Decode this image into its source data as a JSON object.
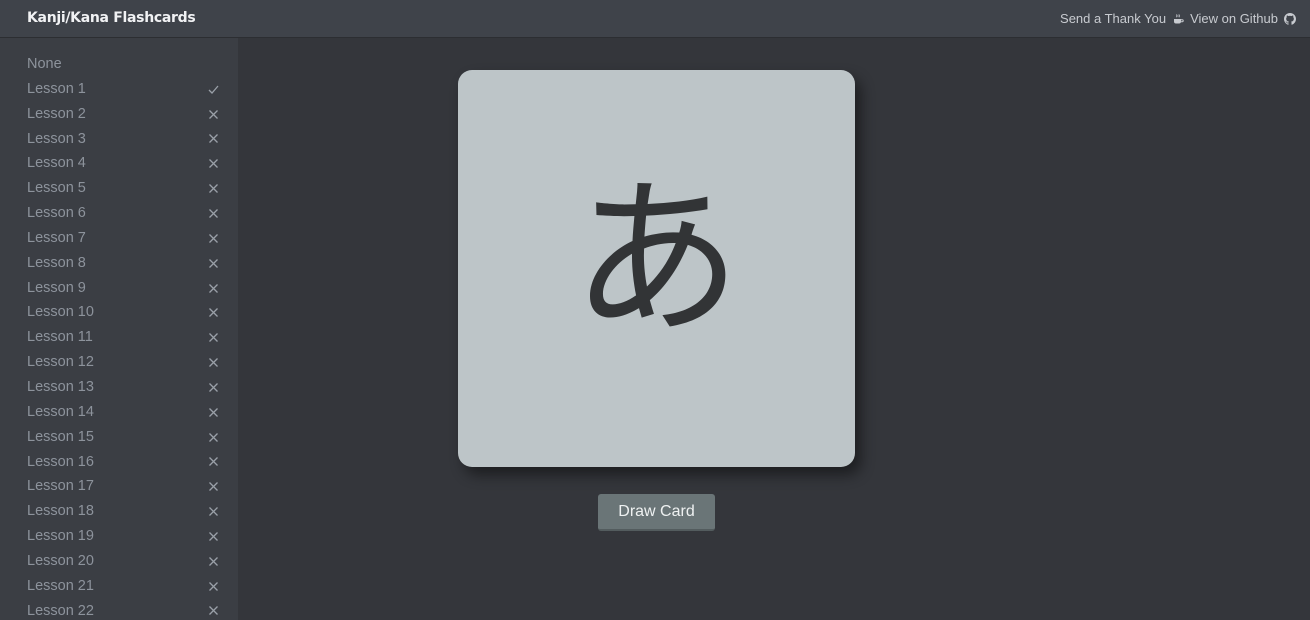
{
  "header": {
    "title": "Kanji/Kana Flashcards",
    "thank_you_label": "Send a Thank You",
    "github_label": "View on Github"
  },
  "sidebar": {
    "items": [
      {
        "label": "None",
        "status": ""
      },
      {
        "label": "Lesson 1",
        "status": "✓"
      },
      {
        "label": "Lesson 2",
        "status": "✕"
      },
      {
        "label": "Lesson 3",
        "status": "✕"
      },
      {
        "label": "Lesson 4",
        "status": "✕"
      },
      {
        "label": "Lesson 5",
        "status": "✕"
      },
      {
        "label": "Lesson 6",
        "status": "✕"
      },
      {
        "label": "Lesson 7",
        "status": "✕"
      },
      {
        "label": "Lesson 8",
        "status": "✕"
      },
      {
        "label": "Lesson 9",
        "status": "✕"
      },
      {
        "label": "Lesson 10",
        "status": "✕"
      },
      {
        "label": "Lesson 11",
        "status": "✕"
      },
      {
        "label": "Lesson 12",
        "status": "✕"
      },
      {
        "label": "Lesson 13",
        "status": "✕"
      },
      {
        "label": "Lesson 14",
        "status": "✕"
      },
      {
        "label": "Lesson 15",
        "status": "✕"
      },
      {
        "label": "Lesson 16",
        "status": "✕"
      },
      {
        "label": "Lesson 17",
        "status": "✕"
      },
      {
        "label": "Lesson 18",
        "status": "✕"
      },
      {
        "label": "Lesson 19",
        "status": "✕"
      },
      {
        "label": "Lesson 20",
        "status": "✕"
      },
      {
        "label": "Lesson 21",
        "status": "✕"
      },
      {
        "label": "Lesson 22",
        "status": "✕"
      }
    ]
  },
  "card": {
    "glyph": "あ"
  },
  "draw_button": {
    "label": "Draw Card"
  },
  "colors": {
    "background": "#34363b",
    "topbar": "#3f434a",
    "sidebar": "#3b3e44",
    "card": "#bdc5c8",
    "button": "#6a7577"
  }
}
